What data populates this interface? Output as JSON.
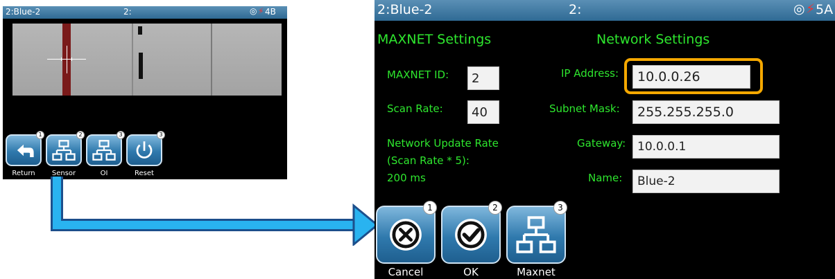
{
  "left_screen": {
    "title_left": "2:Blue-2",
    "title_center": "2:",
    "title_right": "4B",
    "buttons": [
      {
        "label": "Return",
        "badge": "1"
      },
      {
        "label": "Sensor",
        "badge": "2"
      },
      {
        "label": "OI",
        "badge": "3"
      },
      {
        "label": "Reset",
        "badge": "3"
      }
    ]
  },
  "right_screen": {
    "title_left": "2:Blue-2",
    "title_center": "2:",
    "title_right": "5A",
    "maxnet": {
      "heading": "MAXNET Settings",
      "id_label": "MAXNET ID:",
      "id_value": "2",
      "scan_label": "Scan Rate:",
      "scan_value": "40",
      "update_line1": "Network Update Rate",
      "update_line2": "(Scan Rate * 5):",
      "update_value": "200 ms"
    },
    "network": {
      "heading": "Network Settings",
      "ip_label": "IP Address:",
      "ip_value": "10.0.0.26",
      "subnet_label": "Subnet Mask:",
      "subnet_value": "255.255.255.0",
      "gateway_label": "Gateway:",
      "gateway_value": "10.0.0.1",
      "name_label": "Name:",
      "name_value": "Blue-2"
    },
    "buttons": [
      {
        "label": "Cancel",
        "badge": "1"
      },
      {
        "label": "OK",
        "badge": "2"
      },
      {
        "label": "Maxnet",
        "badge": "3"
      }
    ]
  },
  "colors": {
    "highlight": "#f5a800",
    "arrow": "#1fa3e8",
    "label_green": "#2ee62e"
  }
}
